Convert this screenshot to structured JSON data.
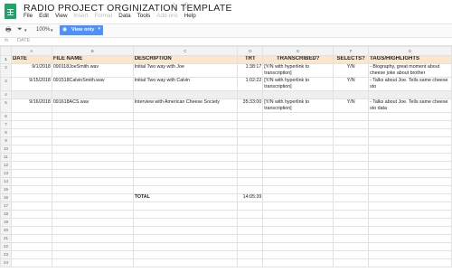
{
  "document": {
    "title": "RADIO PROJECT ORGINIZATION TEMPLATE"
  },
  "menu": [
    "File",
    "Edit",
    "View",
    "Insert",
    "Format",
    "Data",
    "Tools",
    "Add-ons",
    "Help"
  ],
  "menu_disabled": [
    "Insert",
    "Format",
    "Add-ons"
  ],
  "toolbar": {
    "zoom": "100%",
    "view_only_label": "View only",
    "print_icon": "print-icon",
    "filter_icon": "filter-icon"
  },
  "formula_bar": {
    "fx": "fx",
    "value": "DATE"
  },
  "columns": [
    "A",
    "B",
    "C",
    "D",
    "E",
    "F",
    "G"
  ],
  "header_row": [
    "DATE",
    "FILE NAME",
    "DESCRIPTION",
    "TRT",
    "TRANSCRIBED?",
    "SELECTS?",
    "TAGS/HIGHLIGHTS"
  ],
  "rows": [
    {
      "n": "2",
      "date": "9/1/2018",
      "file": "090118JoeSmith.wav",
      "desc": "Initial Two way with Joe",
      "trt": "1:38:17",
      "transcribed": "[Y/N with hyperlink to transcription]",
      "selects": "Y/N",
      "tags": "- Biography, great moment about cheese joke about brother"
    },
    {
      "n": "3",
      "date": "9/15/2018",
      "file": "091518CalvinSmith.wav",
      "desc": "Initial Two way with Calvin",
      "trt": "1:02:22",
      "transcribed": "[Y/N with hyperlink to transcription]",
      "selects": "Y/N",
      "tags": "- Talks about Joe. Tells same cheese sto"
    },
    {
      "n": "4",
      "gray": true
    },
    {
      "n": "5",
      "date": "9/16/2018",
      "file": "091618ACS.wav",
      "desc": "Interview with American Cheese Society",
      "trt": "35:33:00",
      "transcribed": "[Y/N with hyperlink to transcription]",
      "selects": "Y/N",
      "tags": "- Talks about Joe. Tells same cheese sto data"
    }
  ],
  "total": {
    "label": "TOTAL",
    "value": "14:05:39",
    "row": "16"
  },
  "row_numbers": [
    "1",
    "2",
    "3",
    "4",
    "5",
    "6",
    "7",
    "8",
    "9",
    "10",
    "11",
    "12",
    "13",
    "14",
    "15",
    "16",
    "17",
    "18",
    "19",
    "20",
    "21",
    "22",
    "23",
    "24"
  ]
}
